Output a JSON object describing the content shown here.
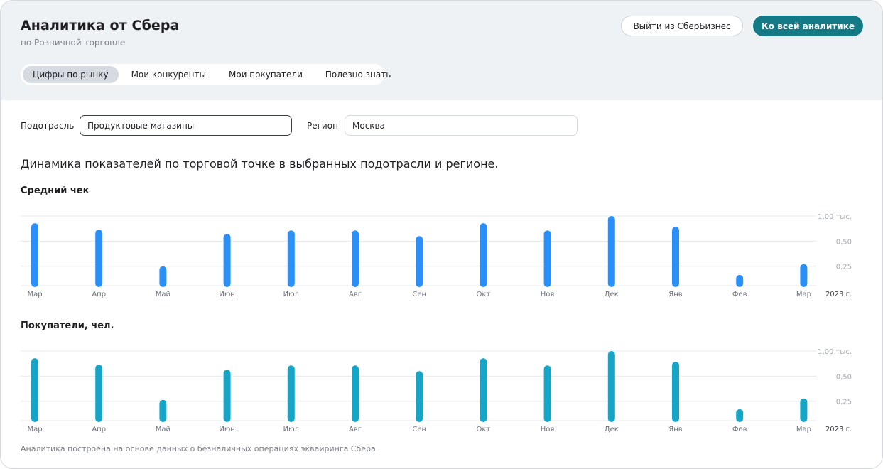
{
  "header": {
    "title": "Аналитика от Сбера",
    "subtitle": "по Розничной торговле",
    "logout_label": "Выйти из СберБизнес",
    "all_analytics_label": "Ко всей аналитике"
  },
  "tabs": [
    {
      "label": "Цифры по рынку",
      "active": true
    },
    {
      "label": "Мои конкуренты",
      "active": false
    },
    {
      "label": "Мои покупатели",
      "active": false
    },
    {
      "label": "Полезно знать",
      "active": false
    }
  ],
  "filters": {
    "subindustry_label": "Подотрасль",
    "subindustry_value": "Продуктовые магазины",
    "region_label": "Регион",
    "region_value": "Москва"
  },
  "section_title": "Динамика показателей по торговой точке в выбранных подотрасли и регионе.",
  "footnote": "Аналитика построена на основе данных о безналичных операциях эквайринга Сбера.",
  "colors": {
    "accent": "#137a86",
    "bar_avg_check": "#2a8ff7",
    "bar_customers": "#16a5c7"
  },
  "chart_data": [
    {
      "type": "bar",
      "title": "Средний чек",
      "categories": [
        "Мар",
        "Апр",
        "Май",
        "Июн",
        "Июл",
        "Авг",
        "Сен",
        "Окт",
        "Ноя",
        "Дек",
        "Янв",
        "Фев",
        "Мар"
      ],
      "values": [
        0.87,
        0.78,
        0.27,
        0.72,
        0.77,
        0.77,
        0.69,
        0.87,
        0.77,
        0.97,
        0.82,
        0.15,
        0.3
      ],
      "ytick_labels": [
        "1,00 тыс.",
        "0,50",
        "0,25"
      ],
      "yticks": [
        0.97,
        0.62,
        0.27
      ],
      "ylim": [
        0,
        1.0
      ],
      "year_label": "2023 г.",
      "grid": true
    },
    {
      "type": "bar",
      "title": "Покупатели, чел.",
      "categories": [
        "Мар",
        "Апр",
        "Май",
        "Июн",
        "Июл",
        "Авг",
        "Сен",
        "Окт",
        "Ноя",
        "Дек",
        "Янв",
        "Фев",
        "Мар"
      ],
      "values": [
        0.87,
        0.78,
        0.29,
        0.71,
        0.77,
        0.77,
        0.69,
        0.87,
        0.77,
        0.97,
        0.82,
        0.16,
        0.31
      ],
      "ytick_labels": [
        "1,00 тыс.",
        "0,50",
        "0,25"
      ],
      "yticks": [
        0.97,
        0.62,
        0.27
      ],
      "ylim": [
        0,
        1.0
      ],
      "year_label": "2023 г.",
      "grid": true
    }
  ]
}
